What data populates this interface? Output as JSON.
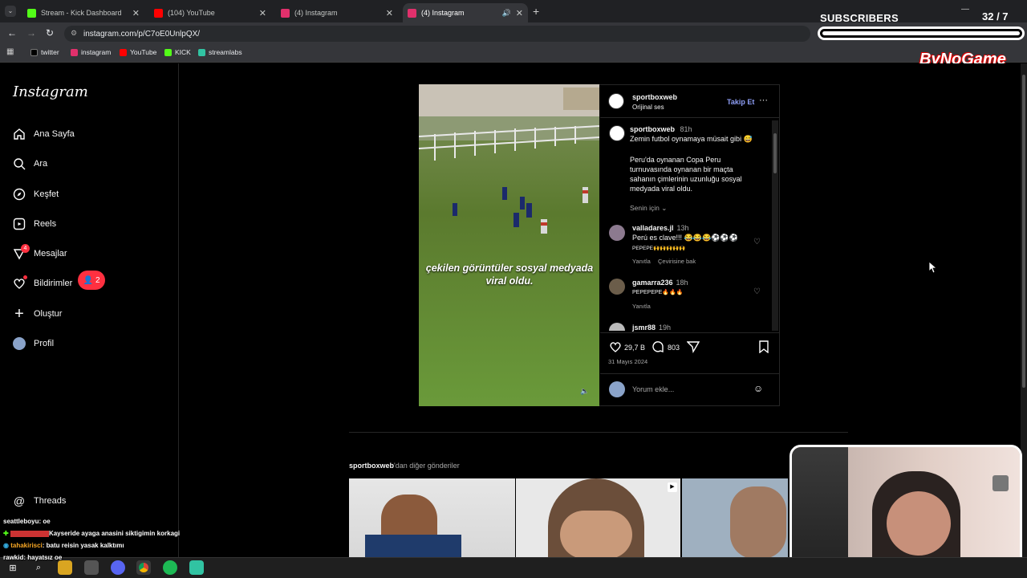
{
  "browser": {
    "tabs": [
      {
        "title": "Stream - Kick Dashboard",
        "color": "#53fc18"
      },
      {
        "title": "(104) YouTube",
        "color": "#ff0000"
      },
      {
        "title": "(4) Instagram",
        "color": "#e1306c"
      },
      {
        "title": "(4) Instagram",
        "color": "#e1306c"
      }
    ],
    "url": "instagram.com/p/C7oE0UnlpQX/",
    "bookmarks": [
      "twitter",
      "instagram",
      "YouTube",
      "KICK",
      "streamlabs"
    ]
  },
  "overlay": {
    "subs_label": "SUBSCRIBERS",
    "subs_count": "32 / 7",
    "brand": "ByNoGame"
  },
  "instagram": {
    "logo": "Instagram",
    "nav": [
      "Ana Sayfa",
      "Ara",
      "Keşfet",
      "Reels",
      "Mesajlar",
      "Bildirimler",
      "Oluştur",
      "Profil"
    ],
    "messages_badge": "4",
    "notif_badge": "2",
    "threads": "Threads"
  },
  "post": {
    "video_caption": "çekilen görüntüler sosyal medyada viral oldu.",
    "author": "sportboxweb",
    "audio": "Orijinal ses",
    "follow": "Takip Et",
    "caption_author": "sportboxweb",
    "caption_time": "81h",
    "caption_line1": "Zemin futbol oynamaya müsait gibi 😅",
    "caption_body": "Peru'da oynanan Copa Peru turnuvasında oynanan bir maçta sahanın çimlerinin uzunluğu sosyal medyada viral oldu.",
    "for_you": "Senin için",
    "comments": [
      {
        "user": "valladares.jl",
        "time": "13h",
        "text": "Perú es clave!!! 😂😂😂⚽⚽⚽",
        "sub": "PEPEPE🙌🙌🙌🙌🙌",
        "reply": "Yanıtla",
        "translate": "Çevirisine bak"
      },
      {
        "user": "gamarra236",
        "time": "18h",
        "text": "PEPEPEPE🔥🔥🔥",
        "reply": "Yanıtla"
      },
      {
        "user": "jsmr88",
        "time": "19h"
      }
    ],
    "likes": "29,7 B",
    "comment_count": "803",
    "date": "31 Mayıs 2024",
    "comment_placeholder": "Yorum ekle..."
  },
  "more": {
    "title_user": "sportboxweb",
    "title_rest": "'dan diğer gönderiler"
  },
  "chat": [
    {
      "user": "seattleboyu",
      "msg": ": oe"
    },
    {
      "user": "",
      "msg": "Kayseride ayaga anasini siktigimin korkagi"
    },
    {
      "user": "tahakirisci",
      "msg": ": batu reisin yasak kalktımı"
    },
    {
      "user": "rawkid",
      "msg": ": hayatsız oe"
    }
  ]
}
